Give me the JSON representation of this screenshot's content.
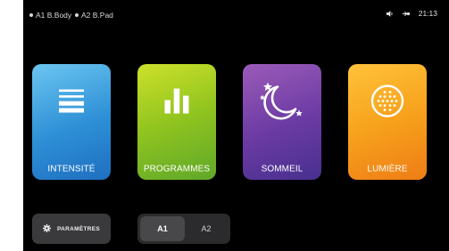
{
  "status_bar": {
    "devices": [
      {
        "label": "A1 B.Body"
      },
      {
        "label": "A2 B.Pad"
      }
    ],
    "time": "21:13",
    "icons": [
      "volume-icon",
      "bluetooth-icon"
    ]
  },
  "tiles": [
    {
      "label": "INTENSITÉ",
      "icon": "intensity-bars-icon",
      "color": "#2d8fd6"
    },
    {
      "label": "PROGRAMMES",
      "icon": "bar-chart-icon",
      "color": "#8fc31f"
    },
    {
      "label": "SOMMEIL",
      "icon": "moon-stars-icon",
      "color": "#6a3aa3"
    },
    {
      "label": "LUMIÈRE",
      "icon": "light-dots-icon",
      "color": "#f7a21c"
    }
  ],
  "settings": {
    "label": "PARAMÈTRES",
    "icon": "gear-icon"
  },
  "selector": {
    "options": [
      "A1",
      "A2"
    ],
    "selected": "A1"
  }
}
